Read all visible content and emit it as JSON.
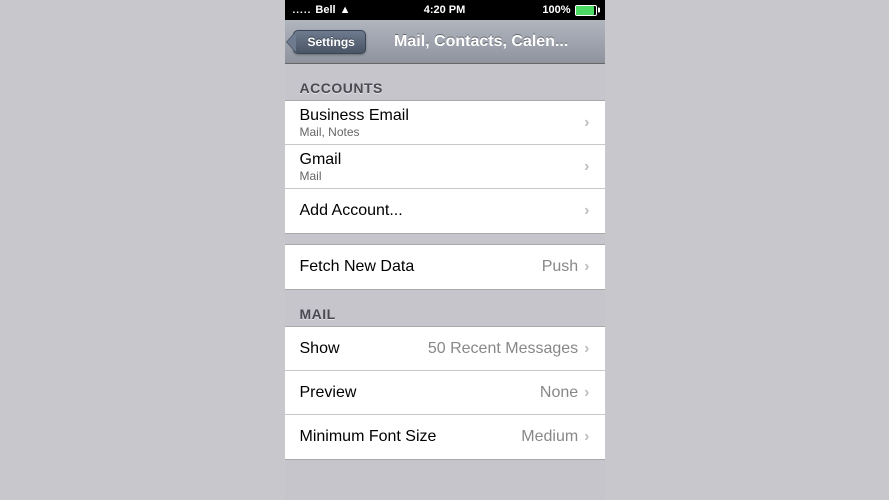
{
  "statusBar": {
    "carrier": "Bell",
    "time": "4:20 PM",
    "battery": "100%",
    "signalDots": ".....",
    "wifi": true
  },
  "navBar": {
    "backLabel": "Settings",
    "title": "Mail, Contacts, Calen..."
  },
  "accounts": {
    "sectionHeader": "Accounts",
    "items": [
      {
        "title": "Business Email",
        "subtitle": "Mail, Notes"
      },
      {
        "title": "Gmail",
        "subtitle": "Mail"
      },
      {
        "title": "Add Account...",
        "subtitle": ""
      }
    ]
  },
  "fetchNewData": {
    "label": "Fetch New Data",
    "value": "Push"
  },
  "mail": {
    "sectionHeader": "Mail",
    "items": [
      {
        "label": "Show",
        "value": "50 Recent Messages"
      },
      {
        "label": "Preview",
        "value": "None"
      },
      {
        "label": "Minimum Font Size",
        "value": "Medium"
      }
    ]
  },
  "icons": {
    "chevron": "❯",
    "wifi": "▲"
  }
}
